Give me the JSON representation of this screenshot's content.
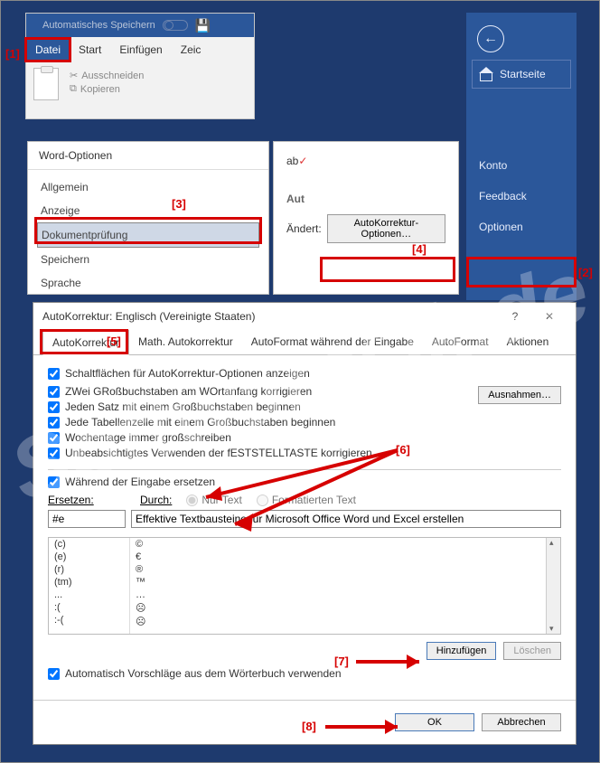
{
  "ribbon": {
    "autosave": "Automatisches Speichern",
    "tabs": {
      "datei": "Datei",
      "start": "Start",
      "einfuegen": "Einfügen",
      "zeich": "Zeic"
    },
    "actions": {
      "cut": "Ausschneiden",
      "copy": "Kopieren"
    }
  },
  "backstage": {
    "startseite": "Startseite",
    "konto": "Konto",
    "feedback": "Feedback",
    "optionen": "Optionen"
  },
  "word_options": {
    "title": "Word-Optionen",
    "items": {
      "allgemein": "Allgemein",
      "anzeige": "Anzeige",
      "dokpruef": "Dokumentprüfung",
      "speichern": "Speichern",
      "sprache": "Sprache"
    }
  },
  "ac_button_panel": {
    "abc": "ab",
    "section": "Aut",
    "label_andert": "Ändert:",
    "button": "AutoKorrektur-Optionen…"
  },
  "dialog": {
    "title": "AutoKorrektur: Englisch (Vereinigte Staaten)",
    "tabs": {
      "autokorrektur": "AutoKorrektur",
      "math": "Math. Autokorrektur",
      "autoformat_eingabe": "AutoFormat während der Eingabe",
      "autoformat": "AutoFormat",
      "aktionen": "Aktionen"
    },
    "checks": {
      "schaltflaechen": "Schaltflächen für AutoKorrektur-Optionen anzeigen",
      "zwei_gross": "ZWei GRoßbuchstaben am WOrtanfang korrigieren",
      "satz_gross": "Jeden Satz mit einem Großbuchstaben beginnen",
      "tabelle_gross": "Jede Tabellenzelle mit einem Großbuchstaben beginnen",
      "wochentage": "Wochentage immer großschreiben",
      "feststell": "Unbeabsichtigtes Verwenden der fESTSTELLTASTE korrigieren",
      "waehrend_eingabe": "Während der Eingabe ersetzen",
      "woerterbuch": "Automatisch Vorschläge aus dem Wörterbuch verwenden"
    },
    "ausnahmen": "Ausnahmen…",
    "ersetzen_label": "Ersetzen:",
    "durch_label": "Durch:",
    "nur_text": "Nur Text",
    "formatiert": "Formatierten Text",
    "input_replace": "#e",
    "input_with": "Effektive Textbausteine für Microsoft Office Word und Excel erstellen",
    "list": [
      {
        "from": "(c)",
        "to": "©"
      },
      {
        "from": "(e)",
        "to": "€"
      },
      {
        "from": "(r)",
        "to": "®"
      },
      {
        "from": "(tm)",
        "to": "™"
      },
      {
        "from": "...",
        "to": "…"
      },
      {
        "from": ":(",
        "to": "☹"
      },
      {
        "from": ":-(",
        "to": "☹"
      }
    ],
    "hinzufuegen": "Hinzufügen",
    "loeschen": "Löschen",
    "ok": "OK",
    "abbrechen": "Abbrechen"
  },
  "annotations": {
    "n1": "[1]",
    "n2": "[2]",
    "n3": "[3]",
    "n4": "[4]",
    "n5": "[5]",
    "n6": "[6]",
    "n7": "[7]",
    "n8": "[8]"
  },
  "watermark": "SoftwareOk.de"
}
